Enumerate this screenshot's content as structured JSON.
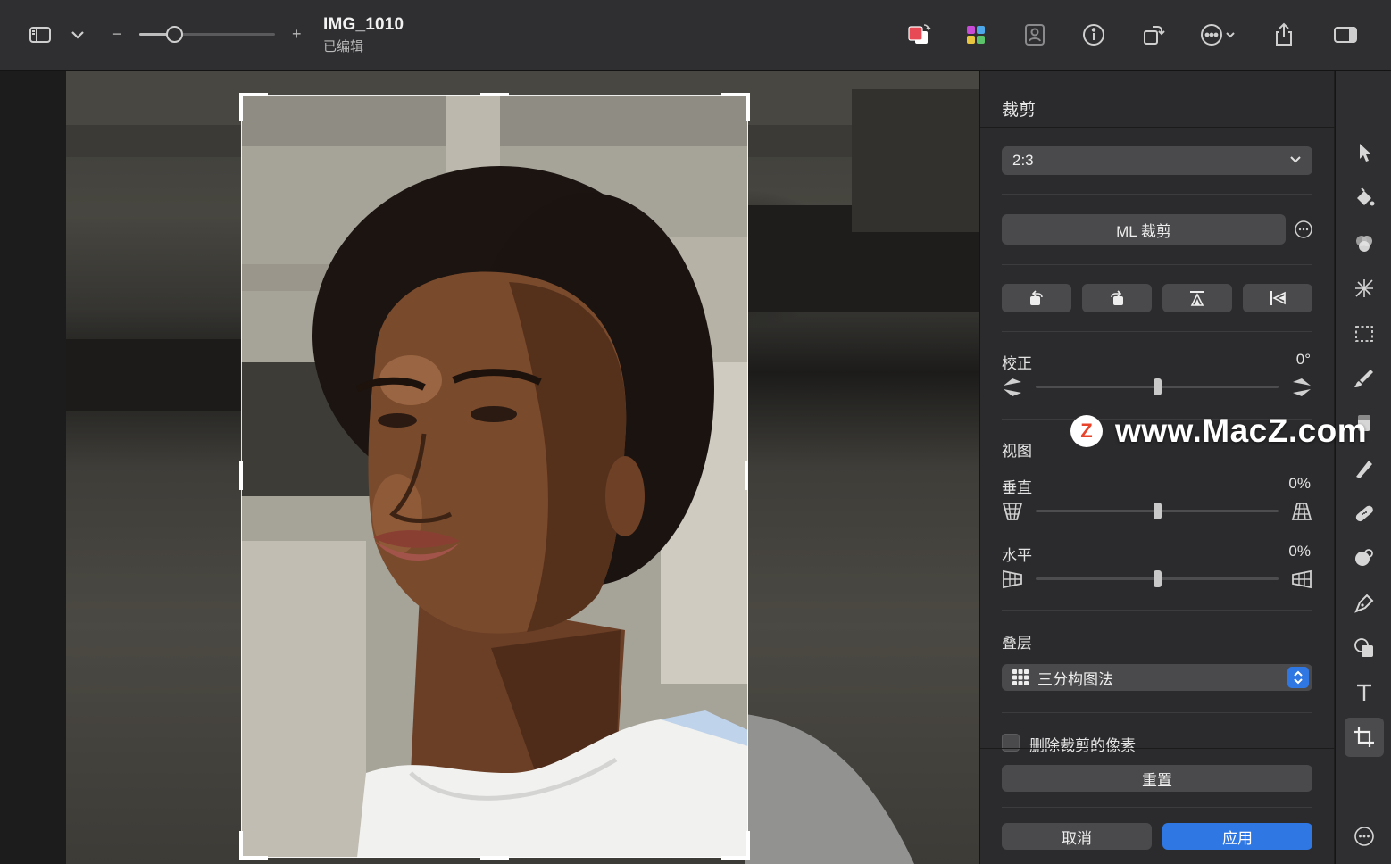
{
  "toolbar": {
    "title": "IMG_1010",
    "subtitle": "已编辑",
    "zoom_minus": "−",
    "zoom_plus": "+",
    "zoom_level": 0.26,
    "icons": [
      "sidebar-toggle-icon",
      "chevron-down-icon",
      "color-swap-icon",
      "color-palette-icon",
      "portrait-icon",
      "info-icon",
      "rotate-icon",
      "more-icon",
      "share-icon",
      "inspector-toggle-icon"
    ]
  },
  "inspector": {
    "title": "裁剪",
    "aspect_ratio": "2:3",
    "ml_crop_label": "ML 裁剪",
    "straighten": {
      "label": "校正",
      "value": "0°",
      "position": 0.5
    },
    "perspective_label": "视图",
    "vertical": {
      "label": "垂直",
      "value": "0%",
      "position": 0.5
    },
    "horizontal": {
      "label": "水平",
      "value": "0%",
      "position": 0.5
    },
    "overlay": {
      "label": "叠层",
      "selected": "三分构图法"
    },
    "delete_cropped_label": "删除裁剪的像素",
    "delete_cropped_checked": false,
    "reset_label": "重置",
    "cancel_label": "取消",
    "apply_label": "应用"
  },
  "rail": {
    "tools": [
      "arrow-icon",
      "paint-bucket-icon",
      "color-adjust-icon",
      "effects-icon",
      "selection-icon",
      "brush-icon",
      "eraser-icon",
      "retouch-icon",
      "bandage-icon",
      "clone-icon",
      "pen-icon",
      "shapes-icon",
      "text-icon",
      "crop-icon"
    ],
    "active": "crop-icon",
    "more": "more-icon"
  },
  "watermark": {
    "logo": "Z",
    "text": "www.MacZ.com"
  },
  "colors": {
    "accent": "#2f77e2",
    "toolbar_bg": "#2f2f31",
    "panel_bg": "#2b2b2d"
  }
}
